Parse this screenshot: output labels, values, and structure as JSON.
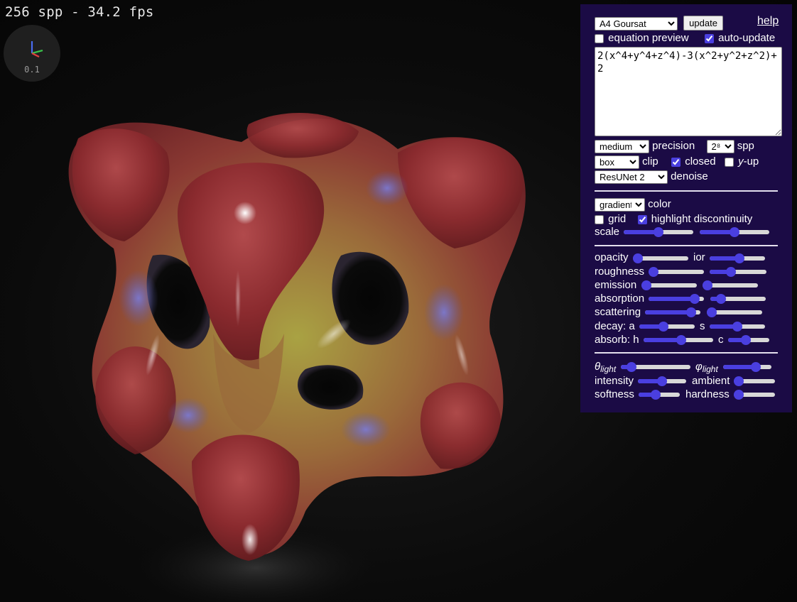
{
  "render": {
    "stats": "256 spp - 34.2 fps",
    "axis_scale": "0.1"
  },
  "panel": {
    "preset": {
      "selected": "A4 Goursat",
      "options": [
        "A4 Goursat"
      ]
    },
    "update_label": "update",
    "help_label": "help",
    "equation_preview": {
      "label": "equation preview",
      "checked": false
    },
    "auto_update": {
      "label": "auto-update",
      "checked": true
    },
    "equation": "2(x^4+y^4+z^4)-3(x^2+y^2+z^2)+2",
    "precision": {
      "selected": "medium",
      "label": "precision"
    },
    "spp": {
      "selected": "2⁸",
      "label": "spp"
    },
    "clip": {
      "selected": "box",
      "label": "clip"
    },
    "closed": {
      "label": "closed",
      "checked": true
    },
    "y_up": {
      "label_var": "y",
      "label_rest": "-up",
      "checked": false
    },
    "denoise": {
      "selected": "ResUNet 2",
      "label": "denoise"
    },
    "color": {
      "selected": "gradient",
      "label": "color"
    },
    "grid": {
      "label": "grid",
      "checked": false
    },
    "highlight": {
      "label": "highlight discontinuity",
      "checked": true
    },
    "labels": {
      "scale": "scale",
      "opacity": "opacity",
      "ior": "ior",
      "roughness": "roughness",
      "emission": "emission",
      "absorption": "absorption",
      "scattering": "scattering",
      "decay_a": "decay: a",
      "decay_s": "s",
      "absorb_h": "absorb: h",
      "absorb_c": "c",
      "theta_sym": "θ",
      "phi_sym": "φ",
      "light_sub": "light",
      "intensity": "intensity",
      "ambient": "ambient",
      "softness": "softness",
      "hardness": "hardness"
    },
    "sliders": {
      "scale_1": 0.5,
      "scale_2": 0.5,
      "opacity": 0.0,
      "ior": 0.55,
      "roughness": 0.0,
      "roughness_2": 0.35,
      "emission": 0.0,
      "emission_2": 0.0,
      "absorption": 0.9,
      "absorption_2": 0.12,
      "scattering": 0.9,
      "scattering_2": 0.0,
      "decay_a": 0.42,
      "decay_s": 0.5,
      "absorb_h": 0.55,
      "absorb_c": 0.4,
      "theta_light": 0.1,
      "phi_light": 0.72,
      "intensity": 0.5,
      "ambient": 0.0,
      "softness": 0.38,
      "hardness": 0.0
    }
  },
  "colors": {
    "panel_bg": "#1b0b45",
    "accent": "#4a3fe0",
    "surface_red": "#8a2a2e",
    "surface_yellow": "#a9a243",
    "surface_blue": "#5a5ab0"
  }
}
